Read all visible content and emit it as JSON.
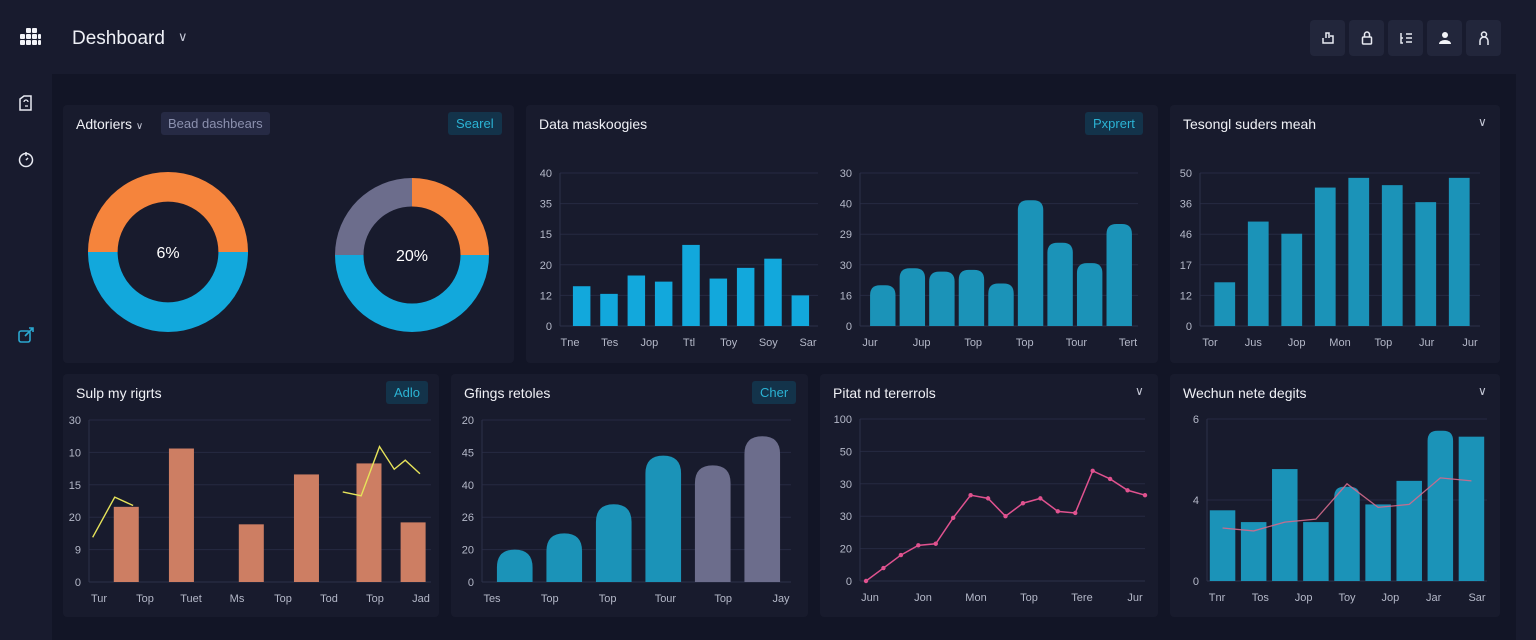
{
  "header": {
    "title": "Deshboard",
    "toolbar_icons": [
      "share-icon",
      "lock-icon",
      "list-icon",
      "user-icon",
      "account-icon"
    ]
  },
  "sidebar": {
    "icons": [
      "bookmark-icon",
      "timer-icon",
      "external-edit-icon"
    ]
  },
  "colors": {
    "accent": "#12a8dc",
    "bar_blue": "#1b93b8",
    "orange": "#f5843c",
    "slate": "#6c6d8c",
    "salmon": "#cd7e63",
    "yellow_line": "#e6e35a",
    "pink_line": "#e0528f"
  },
  "panels": {
    "p1": {
      "title": "Adtoriers",
      "filter_label": "Bead dashbears",
      "action_label": "Searel"
    },
    "p2": {
      "title": "Data maskoogies",
      "action_label": "Pxprert"
    },
    "p3": {
      "title": "Tesongl suders meah"
    },
    "p4": {
      "title": "Sulp my rigrts",
      "action_label": "Adlo"
    },
    "p5": {
      "title": "Gfings retoles",
      "action_label": "Cher"
    },
    "p6": {
      "title": "Pitat nd tererrols"
    },
    "p7": {
      "title": "Wechun nete degits"
    }
  },
  "chart_data": [
    {
      "id": "donut1",
      "type": "pie",
      "title": "Adtoriers",
      "center_label": "6%",
      "slices": [
        {
          "name": "orange",
          "value": 50,
          "color": "#f5843c"
        },
        {
          "name": "blue",
          "value": 50,
          "color": "#12a8dc"
        }
      ]
    },
    {
      "id": "donut2",
      "type": "pie",
      "title": "Adtoriers",
      "center_label": "20%",
      "slices": [
        {
          "name": "orange",
          "value": 25,
          "color": "#f5843c"
        },
        {
          "name": "blue",
          "value": 50,
          "color": "#12a8dc"
        },
        {
          "name": "slate",
          "value": 25,
          "color": "#6c6d8c"
        }
      ]
    },
    {
      "id": "bar1",
      "type": "bar",
      "title": "Data maskoogies",
      "yticks": [
        "0",
        "12",
        "20",
        "15",
        "35",
        "40"
      ],
      "xlabels": [
        "Tne",
        "Tes",
        "Jop",
        "Ttl",
        "Toy",
        "Soy",
        "Sar"
      ],
      "values": [
        13,
        10.5,
        16.5,
        14.5,
        26.5,
        15.5,
        19,
        22,
        10
      ],
      "ylim": [
        0,
        50
      ],
      "color": "#12a8dc"
    },
    {
      "id": "bar2",
      "type": "bar",
      "title": "Data maskoogies",
      "yticks": [
        "0",
        "16",
        "30",
        "29",
        "40",
        "30"
      ],
      "xlabels": [
        "Jur",
        "Jup",
        "Top",
        "Top",
        "Tour",
        "Tert"
      ],
      "values": [
        24,
        34,
        32,
        33,
        25,
        74,
        49,
        37,
        60
      ],
      "ylim": [
        0,
        90
      ],
      "color": "#1b93b8"
    },
    {
      "id": "bar3",
      "type": "bar",
      "title": "Tesongl suders meah",
      "yticks": [
        "0",
        "12",
        "17",
        "46",
        "36",
        "50"
      ],
      "xlabels": [
        "Tor",
        "Jus",
        "Jop",
        "Mon",
        "Top",
        "Jur",
        "Jur"
      ],
      "values": [
        18,
        43,
        38,
        57,
        61,
        58,
        51,
        61
      ],
      "ylim": [
        0,
        63
      ],
      "color": "#1b93b8"
    },
    {
      "id": "combo1",
      "type": "bar",
      "title": "Sulp my rigrts",
      "yticks": [
        "0",
        "9",
        "20",
        "15",
        "10",
        "30"
      ],
      "xlabels": [
        "Tur",
        "Top",
        "Tuet",
        "Ms",
        "Top",
        "Tod",
        "Top",
        "Jad"
      ],
      "bars": [
        {
          "x": 1,
          "value": 11.6
        },
        {
          "x": 2.5,
          "value": 20.6
        },
        {
          "x": 4.4,
          "value": 8.9
        },
        {
          "x": 5.9,
          "value": 16.6
        },
        {
          "x": 7.6,
          "value": 18.3
        },
        {
          "x": 8.8,
          "value": 9.2
        }
      ],
      "line": [
        {
          "x": 0.1,
          "value": 6.9
        },
        {
          "x": 0.7,
          "value": 13.1
        },
        {
          "x": 1.2,
          "value": 11.8
        },
        {
          "x": 6.9,
          "value": 13.9
        },
        {
          "x": 7.4,
          "value": 13.3
        },
        {
          "x": 7.9,
          "value": 20.9
        },
        {
          "x": 8.3,
          "value": 17.4
        },
        {
          "x": 8.6,
          "value": 18.8
        },
        {
          "x": 9.0,
          "value": 16.7
        }
      ],
      "ylim": [
        0,
        25
      ],
      "bar_color": "#cd7e63",
      "line_color": "#e6e35a"
    },
    {
      "id": "bar4",
      "type": "bar",
      "title": "Gfings retoles",
      "yticks": [
        "0",
        "20",
        "26",
        "40",
        "45",
        "20"
      ],
      "xlabels": [
        "Tes",
        "Top",
        "Top",
        "Tour",
        "Top",
        "Jay"
      ],
      "values": [
        10,
        15,
        24,
        39,
        36,
        45
      ],
      "colors": [
        "#1b93b8",
        "#1b93b8",
        "#1b93b8",
        "#1b93b8",
        "#6c6d8c",
        "#6c6d8c"
      ],
      "ylim": [
        0,
        50
      ]
    },
    {
      "id": "line1",
      "type": "line",
      "title": "Pitat nd tererrols",
      "yticks": [
        "0",
        "20",
        "30",
        "30",
        "50",
        "100"
      ],
      "xlabels": [
        "Jun",
        "Jon",
        "Mon",
        "Top",
        "Tere",
        "Jur"
      ],
      "values": [
        0,
        8,
        16,
        22,
        23,
        39,
        53,
        51,
        40,
        48,
        51,
        43,
        42,
        68,
        63,
        56,
        53
      ],
      "ylim": [
        0,
        100
      ],
      "color": "#e0528f"
    },
    {
      "id": "combo2",
      "type": "bar",
      "title": "Wechun nete degits",
      "yticks": [
        "0",
        "4",
        "6"
      ],
      "xlabels": [
        "Tnr",
        "Tos",
        "Jop",
        "Toy",
        "Jop",
        "Jar",
        "Sar"
      ],
      "values": [
        2.4,
        2.0,
        3.8,
        2.0,
        3.2,
        2.6,
        3.4,
        5.1,
        4.9
      ],
      "line": [
        1.8,
        1.7,
        2.0,
        2.1,
        3.3,
        2.5,
        2.6,
        3.5,
        3.4
      ],
      "ylim": [
        0,
        5.5
      ],
      "bar_color": "#1b93b8",
      "line_color": "#d46a8c"
    }
  ]
}
